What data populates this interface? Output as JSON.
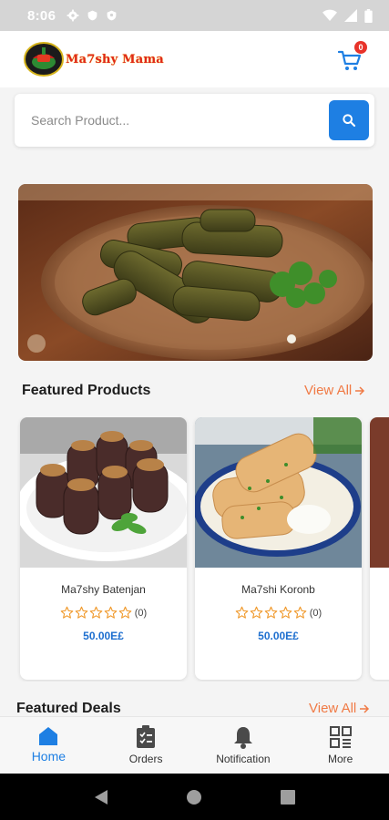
{
  "status_bar": {
    "time": "8:06",
    "icons_left": [
      "gear-icon",
      "shield-icon",
      "shield-outline-icon"
    ],
    "icons_right": [
      "wifi-icon",
      "signal-icon",
      "battery-icon"
    ]
  },
  "header": {
    "logo_text": "Ma7shy Mama",
    "cart_count": "0"
  },
  "search": {
    "placeholder": "Search Product..."
  },
  "featured_products": {
    "title": "Featured Products",
    "view_all": "View All",
    "items": [
      {
        "name": "Ma7shy Batenjan",
        "rating": 0,
        "stars_max": 5,
        "rating_count": "(0)",
        "price": "50.00E£"
      },
      {
        "name": "Ma7shi Koronb",
        "rating": 0,
        "stars_max": 5,
        "rating_count": "(0)",
        "price": "50.00E£"
      }
    ]
  },
  "featured_deals": {
    "title": "Featured Deals",
    "view_all": "View All"
  },
  "bottom_nav": {
    "items": [
      {
        "label": "Home",
        "icon": "home-icon",
        "active": true
      },
      {
        "label": "Orders",
        "icon": "orders-icon",
        "active": false
      },
      {
        "label": "Notification",
        "icon": "bell-icon",
        "active": false
      },
      {
        "label": "More",
        "icon": "grid-icon",
        "active": false
      }
    ]
  },
  "colors": {
    "accent": "#1e7fe3",
    "view_all": "#f07a45",
    "price": "#1e6fcf",
    "star": "#f09a2d",
    "badge": "#e8332a"
  }
}
